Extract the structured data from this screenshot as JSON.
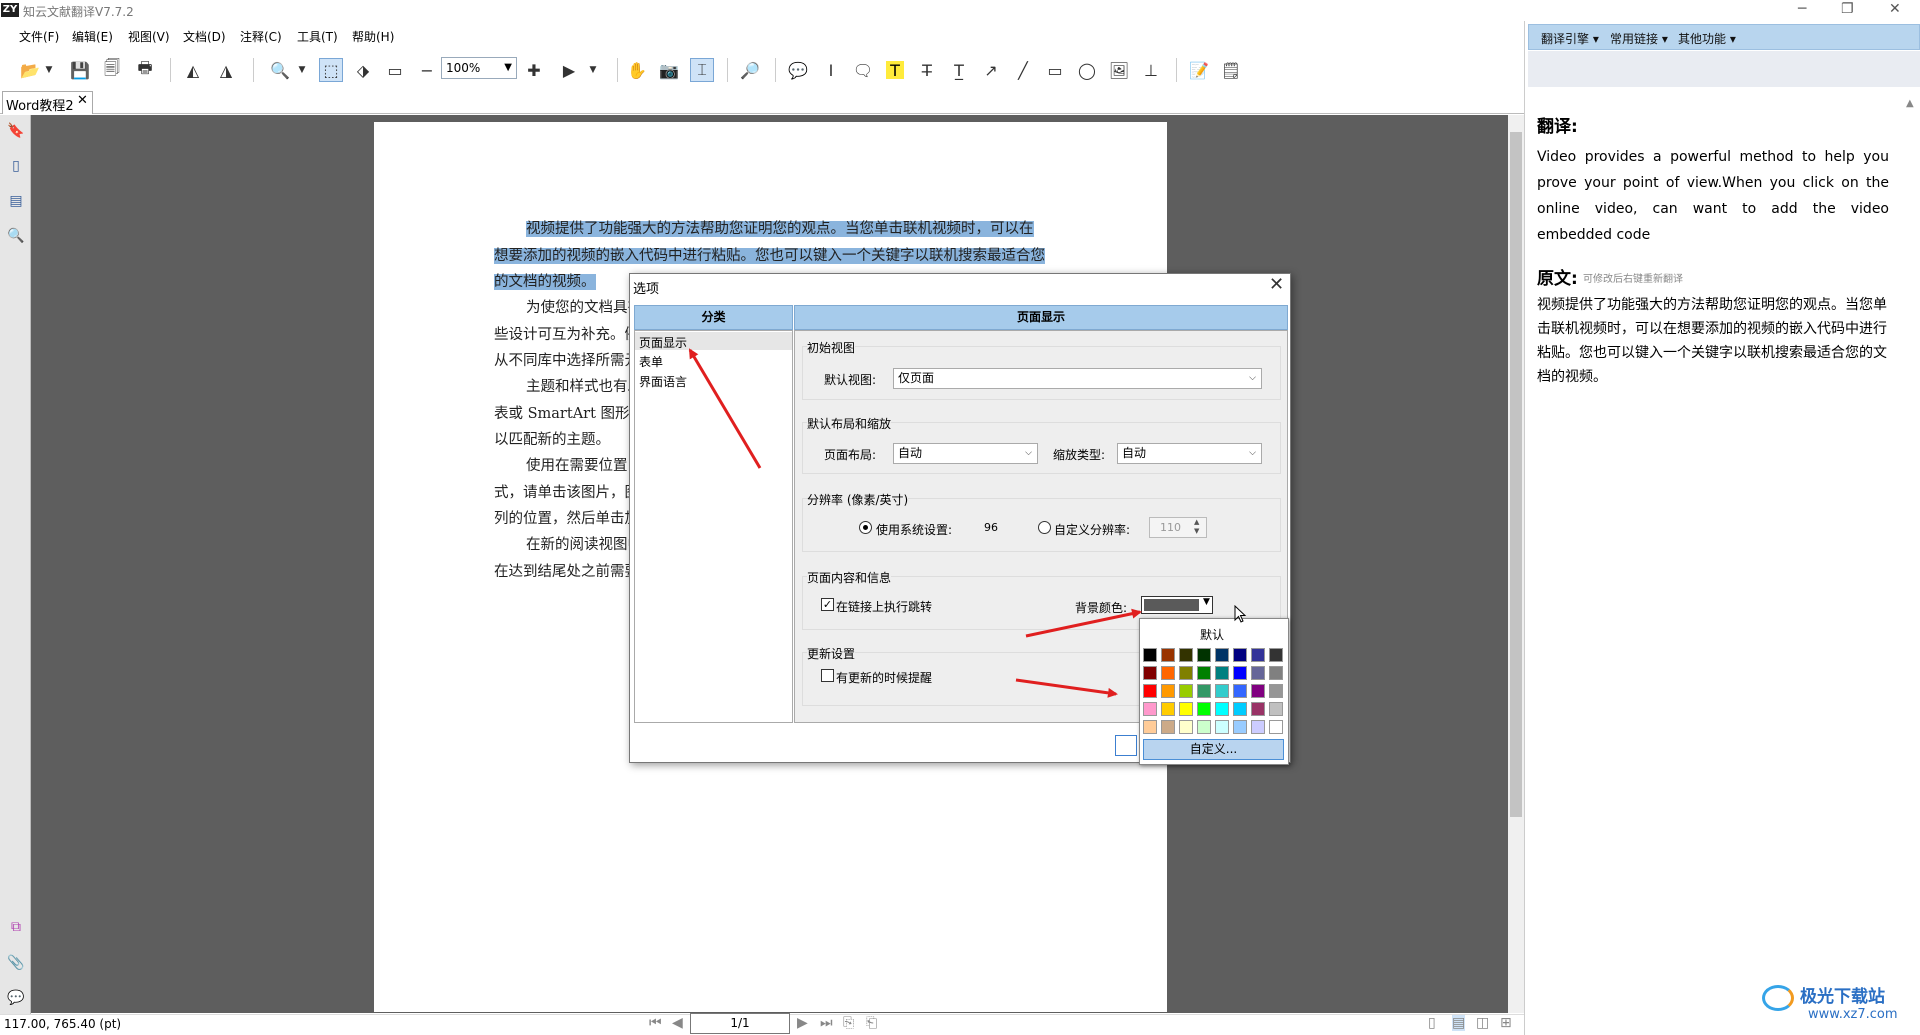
{
  "app": {
    "logo": "ZY",
    "title": "知云文献翻译V7.7.2"
  },
  "window_controls": [
    "─",
    "❐",
    "✕"
  ],
  "menu": [
    "文件(F)",
    "编辑(E)",
    "视图(V)",
    "文档(D)",
    "注释(C)",
    "工具(T)",
    "帮助(H)"
  ],
  "toolbar": {
    "zoom": "100%"
  },
  "tab": {
    "name": "Word教程2",
    "close": "✕"
  },
  "document": {
    "paragraphs": [
      {
        "text": "视频提供了功能强大的方法帮助您证明您的观点。当您单击联机视频时，可以在想要添加的视频的嵌入代码中进行粘贴。您也可以键入一个关键字以联机搜索最适合您的文档的视频。",
        "highlighted": true
      },
      {
        "text": "为使您的文档具有专业外观，Word 提供了页眉、页脚、封面和文本框设计，这些设计可互为补充。例如，您可以添加匹配的封面、页眉和提要栏。单击“插入”，然后从不同库中选择所需元素。",
        "highlighted": false
      },
      {
        "text": "主题和样式也有助于文档保持协调。当您单击设计并选择新的主题时，图片、图表或 SmartArt 图形将会更改以匹配新的主题。当应用样式时，您的标题会进行更改以匹配新的主题。",
        "highlighted": false
      },
      {
        "text": "使用在需要位置出现的新按钮在 Word 中保存时间。若要更改图片适应文档的方式，请单击该图片，图片旁边将会显示布局选项按钮。当处理表格时，单击要添加行或列的位置，然后单击加号。",
        "highlighted": false
      },
      {
        "text": "在新的阅读视图中阅读更加容易。可以折叠文档某些部分并关注所需文本。如果在达到结尾处之前需要停止读取，Word 会记住您的停止位置 - 即使在另一个设备上。",
        "highlighted": false
      }
    ]
  },
  "status": {
    "coords": "117.00, 765.40 (pt)",
    "page": "1/1"
  },
  "right_panel": {
    "tabs": [
      "翻译引擎 ▾",
      "常用链接 ▾",
      "其他功能 ▾"
    ],
    "translation_label": "翻译:",
    "translation_text": "Video provides a powerful method to help you prove your point of view.When you click on the online video, can want to add the video embedded code",
    "original_label": "原文:",
    "original_hint": "可修改后右键重新翻译",
    "original_text": "视频提供了功能强大的方法帮助您证明您的观点。当您单击联机视频时，可以在想要添加的视频的嵌入代码中进行粘贴。您也可以键入一个关键字以联机搜索最适合您的文档的视频。"
  },
  "dialog": {
    "title": "选项",
    "close": "✕",
    "category_header": "分类",
    "categories": [
      "页面显示",
      "表单",
      "界面语言"
    ],
    "main_header": "页面显示",
    "initial_view": {
      "group": "初始视图",
      "label": "默认视图:",
      "value": "仅页面"
    },
    "layout_zoom": {
      "group": "默认布局和缩放",
      "layout_label": "页面布局:",
      "layout_value": "自动",
      "zoom_label": "缩放类型:",
      "zoom_value": "自动"
    },
    "resolution": {
      "group": "分辨率 (像素/英寸)",
      "system_label": "使用系统设置:",
      "system_value": "96",
      "custom_label": "自定义分辨率:",
      "custom_value": "110",
      "selected": "system"
    },
    "content": {
      "group": "页面内容和信息",
      "link_label": "在链接上执行跳转",
      "link_checked": true,
      "bg_label": "背景颜色:",
      "bg_color": "#5a5a5a"
    },
    "update": {
      "group": "更新设置",
      "remind_label": "有更新的时候提醒",
      "remind_checked": false
    }
  },
  "palette": {
    "default_label": "默认",
    "custom_label": "自定义...",
    "colors": [
      "#000000",
      "#993300",
      "#333300",
      "#003300",
      "#003366",
      "#000080",
      "#333399",
      "#333333",
      "#800000",
      "#ff6600",
      "#808000",
      "#008000",
      "#008080",
      "#0000ff",
      "#666699",
      "#808080",
      "#ff0000",
      "#ff9900",
      "#99cc00",
      "#339966",
      "#33cccc",
      "#3366ff",
      "#800080",
      "#969696",
      "#ff99cc",
      "#ffcc00",
      "#ffff00",
      "#00ff00",
      "#00ffff",
      "#00ccff",
      "#993366",
      "#c0c0c0",
      "#ffcc99",
      "#ccaa88",
      "#ffffcc",
      "#ccffcc",
      "#ccffff",
      "#99ccff",
      "#ccccff",
      "#ffffff"
    ]
  },
  "watermark": {
    "brand": "极光下载站",
    "url": "www.xz7.com"
  }
}
